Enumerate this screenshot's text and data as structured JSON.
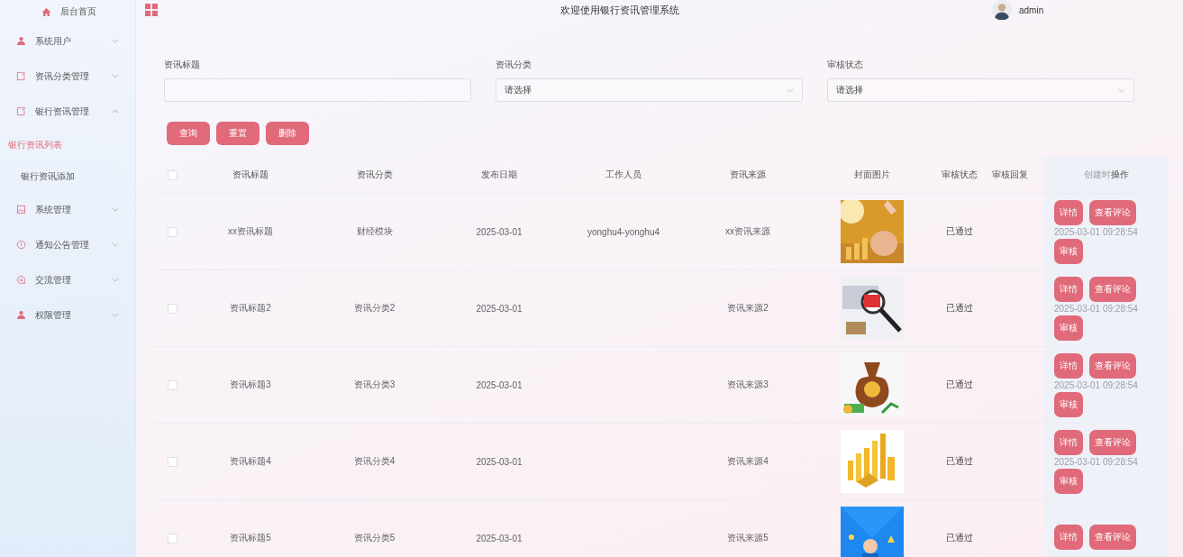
{
  "sidebar": {
    "items": [
      {
        "label": "后台首页"
      },
      {
        "label": "系统用户",
        "expanded": false
      },
      {
        "label": "资讯分类管理",
        "expanded": false
      },
      {
        "label": "银行资讯管理",
        "expanded": true,
        "children": [
          {
            "label": "银行资讯列表",
            "selected": true
          },
          {
            "label": "银行资讯添加",
            "selected": false
          }
        ]
      },
      {
        "label": "系统管理",
        "expanded": false
      },
      {
        "label": "通知公告管理",
        "expanded": false
      },
      {
        "label": "交流管理",
        "expanded": false
      },
      {
        "label": "权限管理",
        "expanded": false
      }
    ]
  },
  "header": {
    "title": "欢迎使用银行资讯管理系统",
    "user": "admin"
  },
  "search": {
    "fields": [
      {
        "kind": "input",
        "label": "资讯标题"
      },
      {
        "kind": "select",
        "label": "资讯分类",
        "placeholder": "请选择"
      },
      {
        "kind": "select",
        "label": "审核状态",
        "placeholder": "请选择"
      }
    ],
    "buttons": [
      "查询",
      "重置",
      "删除"
    ]
  },
  "table": {
    "select_all": {
      "checked": false
    },
    "columns": [
      "资讯标题",
      "资讯分类",
      "发布日期",
      "工作人员",
      "资讯来源",
      "封面图片",
      "审核状态",
      "审核回复"
    ],
    "created_column": "创建时",
    "action_column": "操作",
    "rows": [
      {
        "checked": false,
        "cells": [
          "xx资讯标题",
          "财经模块",
          "2025-03-01",
          "yonghu4-yonghu4",
          "xx资讯来源"
        ],
        "cover": {
          "kind": "picture"
        },
        "status": "已通过",
        "created": "2025-03-01 09:28:54",
        "actions": [
          "详情",
          "查看评论",
          "审核"
        ]
      },
      {
        "checked": false,
        "cells": [
          "资讯标题2",
          "资讯分类2",
          "2025-03-01",
          "",
          "资讯来源2"
        ],
        "cover": {
          "kind": "picture"
        },
        "status": "已通过",
        "created": "2025-03-01 09:28:54",
        "actions": [
          "详情",
          "查看评论",
          "审核"
        ]
      },
      {
        "checked": false,
        "cells": [
          "资讯标题3",
          "资讯分类3",
          "2025-03-01",
          "",
          "资讯来源3"
        ],
        "cover": {
          "kind": "picture"
        },
        "status": "已通过",
        "created": "2025-03-01 09:28:54",
        "actions": [
          "详情",
          "查看评论",
          "审核"
        ]
      },
      {
        "checked": false,
        "cells": [
          "资讯标题4",
          "资讯分类4",
          "2025-03-01",
          "",
          "资讯来源4"
        ],
        "cover": {
          "kind": "picture"
        },
        "status": "已通过",
        "created": "2025-03-01 09:28:54",
        "actions": [
          "详情",
          "查看评论",
          "审核"
        ]
      },
      {
        "checked": false,
        "cells": [
          "资讯标题5",
          "资讯分类5",
          "2025-03-01",
          "",
          "资讯来源5"
        ],
        "cover": {
          "kind": "picture"
        },
        "status": "已通过",
        "actions": [
          "详情",
          "查看评论"
        ]
      }
    ]
  }
}
